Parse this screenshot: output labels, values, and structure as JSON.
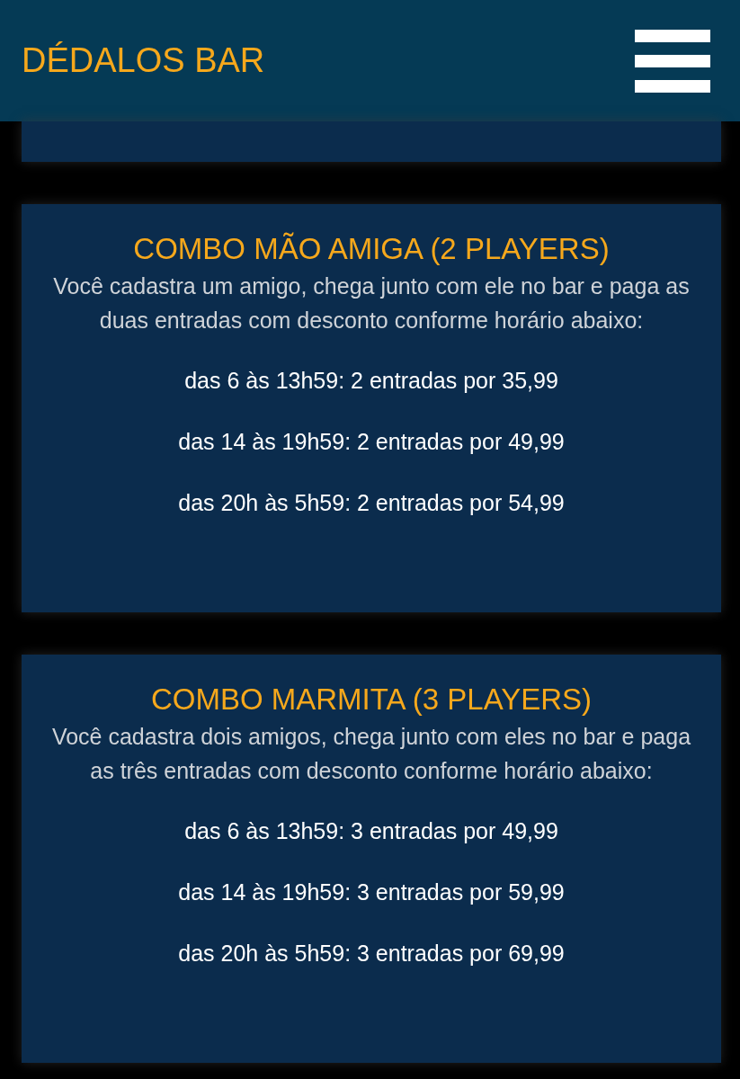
{
  "header": {
    "title": "DÉDALOS BAR"
  },
  "combos": [
    {
      "title": "COMBO MÃO AMIGA (2 PLAYERS)",
      "description": "Você cadastra um amigo, chega junto com ele no bar e paga as duas entradas com desconto conforme horário abaixo:",
      "prices": [
        "das 6 às 13h59: 2 entradas por 35,99",
        "das 14 às 19h59: 2 entradas por 49,99",
        "das 20h às 5h59: 2 entradas por 54,99"
      ]
    },
    {
      "title": "COMBO MARMITA (3 PLAYERS)",
      "description": "Você cadastra dois amigos, chega junto com eles no bar e paga as três entradas com desconto conforme horário abaixo:",
      "prices": [
        "das 6 às 13h59: 3 entradas por 49,99",
        "das 14 às 19h59: 3 entradas por 59,99",
        "das 20h às 5h59: 3 entradas por 69,99"
      ]
    }
  ]
}
